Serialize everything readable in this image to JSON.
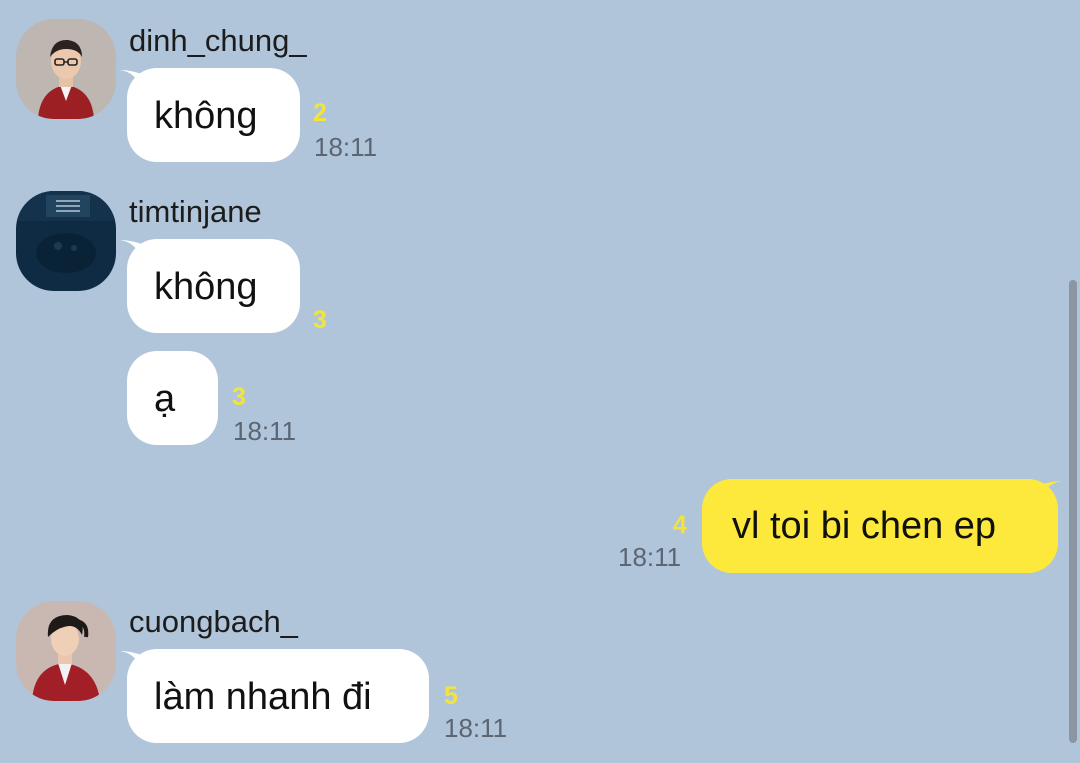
{
  "messages": [
    {
      "sender": "dinh_chung_",
      "avatar_icon": "man-portrait-red-jacket-glasses-avatar",
      "text": "không",
      "unread": "2",
      "time": "18:11"
    },
    {
      "sender": "timtinjane",
      "avatar_icon": "dark-blue-scene-avatar",
      "text": "không",
      "unread": "3"
    },
    {
      "text": "ạ",
      "unread": "3",
      "time": "18:11"
    },
    {
      "text": "vl toi bi chen ep",
      "unread": "4",
      "time": "18:11",
      "outgoing": true
    },
    {
      "sender": "cuongbach_",
      "avatar_icon": "man-portrait-red-jacket-avatar",
      "text": "làm nhanh đi",
      "unread": "5",
      "time": "18:11"
    }
  ],
  "colors": {
    "background": "#b0c5da",
    "incoming_bubble": "#ffffff",
    "outgoing_bubble": "#fde93b",
    "unread_count": "#f2e43a",
    "timestamp": "#5b6672"
  }
}
